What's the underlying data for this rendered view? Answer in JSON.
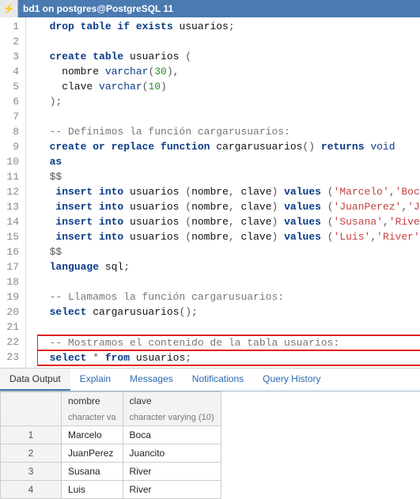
{
  "header": {
    "title": "bd1 on postgres@PostgreSQL 11"
  },
  "code_lines": [
    {
      "n": 1,
      "tokens": [
        [
          "kw",
          "  drop"
        ],
        [
          "kw",
          " table"
        ],
        [
          "kw",
          " if"
        ],
        [
          "kw",
          " exists"
        ],
        [
          "fn",
          " usuarios"
        ],
        [
          "pn",
          ";"
        ]
      ]
    },
    {
      "n": 2,
      "tokens": []
    },
    {
      "n": 3,
      "tokens": [
        [
          "kw",
          "  create"
        ],
        [
          "kw",
          " table"
        ],
        [
          "fn",
          " usuarios"
        ],
        [
          "pn",
          " ("
        ]
      ]
    },
    {
      "n": 4,
      "tokens": [
        [
          "fn",
          "    nombre "
        ],
        [
          "ty",
          "varchar"
        ],
        [
          "pn",
          "("
        ],
        [
          "num",
          "30"
        ],
        [
          "pn",
          "),"
        ]
      ]
    },
    {
      "n": 5,
      "tokens": [
        [
          "fn",
          "    clave "
        ],
        [
          "ty",
          "varchar"
        ],
        [
          "pn",
          "("
        ],
        [
          "num",
          "10"
        ],
        [
          "pn",
          ")"
        ]
      ]
    },
    {
      "n": 6,
      "tokens": [
        [
          "pn",
          "  );"
        ]
      ]
    },
    {
      "n": 7,
      "tokens": []
    },
    {
      "n": 8,
      "tokens": [
        [
          "cm",
          "  -- Definimos la función cargarusuarios:"
        ]
      ]
    },
    {
      "n": 9,
      "tokens": [
        [
          "kw",
          "  create"
        ],
        [
          "kw",
          " or"
        ],
        [
          "kw",
          " replace"
        ],
        [
          "kw",
          " function"
        ],
        [
          "fn",
          " cargarusuarios"
        ],
        [
          "pn",
          "()"
        ],
        [
          "kw",
          " returns"
        ],
        [
          "ty",
          " void"
        ]
      ]
    },
    {
      "n": 10,
      "tokens": [
        [
          "kw",
          "  as"
        ]
      ]
    },
    {
      "n": 11,
      "tokens": [
        [
          "pn",
          "  $$"
        ]
      ]
    },
    {
      "n": 12,
      "tokens": [
        [
          "kw",
          "   insert"
        ],
        [
          "kw",
          " into"
        ],
        [
          "fn",
          " usuarios"
        ],
        [
          "pn",
          " ("
        ],
        [
          "fn",
          "nombre"
        ],
        [
          "pn",
          ", "
        ],
        [
          "fn",
          "clave"
        ],
        [
          "pn",
          ")"
        ],
        [
          "kw",
          " values"
        ],
        [
          "pn",
          " ("
        ],
        [
          "str",
          "'Marcelo'"
        ],
        [
          "pn",
          ","
        ],
        [
          "str",
          "'Boca'"
        ],
        [
          "pn",
          ");"
        ]
      ]
    },
    {
      "n": 13,
      "tokens": [
        [
          "kw",
          "   insert"
        ],
        [
          "kw",
          " into"
        ],
        [
          "fn",
          " usuarios"
        ],
        [
          "pn",
          " ("
        ],
        [
          "fn",
          "nombre"
        ],
        [
          "pn",
          ", "
        ],
        [
          "fn",
          "clave"
        ],
        [
          "pn",
          ")"
        ],
        [
          "kw",
          " values"
        ],
        [
          "pn",
          " ("
        ],
        [
          "str",
          "'JuanPerez'"
        ],
        [
          "pn",
          ","
        ],
        [
          "str",
          "'Juancito'"
        ],
        [
          "pn",
          ");"
        ]
      ]
    },
    {
      "n": 14,
      "tokens": [
        [
          "kw",
          "   insert"
        ],
        [
          "kw",
          " into"
        ],
        [
          "fn",
          " usuarios"
        ],
        [
          "pn",
          " ("
        ],
        [
          "fn",
          "nombre"
        ],
        [
          "pn",
          ", "
        ],
        [
          "fn",
          "clave"
        ],
        [
          "pn",
          ")"
        ],
        [
          "kw",
          " values"
        ],
        [
          "pn",
          " ("
        ],
        [
          "str",
          "'Susana'"
        ],
        [
          "pn",
          ","
        ],
        [
          "str",
          "'River'"
        ],
        [
          "pn",
          ");"
        ]
      ]
    },
    {
      "n": 15,
      "tokens": [
        [
          "kw",
          "   insert"
        ],
        [
          "kw",
          " into"
        ],
        [
          "fn",
          " usuarios"
        ],
        [
          "pn",
          " ("
        ],
        [
          "fn",
          "nombre"
        ],
        [
          "pn",
          ", "
        ],
        [
          "fn",
          "clave"
        ],
        [
          "pn",
          ")"
        ],
        [
          "kw",
          " values"
        ],
        [
          "pn",
          " ("
        ],
        [
          "str",
          "'Luis'"
        ],
        [
          "pn",
          ","
        ],
        [
          "str",
          "'River'"
        ],
        [
          "pn",
          ");"
        ]
      ]
    },
    {
      "n": 16,
      "tokens": [
        [
          "pn",
          "  $$"
        ]
      ]
    },
    {
      "n": 17,
      "tokens": [
        [
          "kw",
          "  language"
        ],
        [
          "fn",
          " sql"
        ],
        [
          "pn",
          ";"
        ]
      ]
    },
    {
      "n": 18,
      "tokens": []
    },
    {
      "n": 19,
      "tokens": [
        [
          "cm",
          "  -- Llamamos la función cargarusuarios:"
        ]
      ]
    },
    {
      "n": 20,
      "tokens": [
        [
          "kw",
          "  select"
        ],
        [
          "fn",
          " cargarusuarios"
        ],
        [
          "pn",
          "();"
        ]
      ]
    },
    {
      "n": 21,
      "tokens": []
    },
    {
      "n": 22,
      "hl": "top",
      "tokens": [
        [
          "cm",
          "  -- Mostramos el contenido de la tabla usuarios:"
        ]
      ]
    },
    {
      "n": 23,
      "hl": "bot",
      "tokens": [
        [
          "kw",
          "  select"
        ],
        [
          "pn",
          " * "
        ],
        [
          "kw",
          "from"
        ],
        [
          "fn",
          " usuarios"
        ],
        [
          "pn",
          ";"
        ]
      ]
    }
  ],
  "tabs": {
    "items": [
      {
        "label": "Data Output",
        "active": true
      },
      {
        "label": "Explain",
        "active": false
      },
      {
        "label": "Messages",
        "active": false
      },
      {
        "label": "Notifications",
        "active": false
      },
      {
        "label": "Query History",
        "active": false
      }
    ]
  },
  "result": {
    "columns": [
      {
        "name": "nombre",
        "type": "character va"
      },
      {
        "name": "clave",
        "type": "character varying (10)"
      }
    ],
    "rows": [
      {
        "n": 1,
        "cells": [
          "Marcelo",
          "Boca"
        ]
      },
      {
        "n": 2,
        "cells": [
          "JuanPerez",
          "Juancito"
        ]
      },
      {
        "n": 3,
        "cells": [
          "Susana",
          "River"
        ]
      },
      {
        "n": 4,
        "cells": [
          "Luis",
          "River"
        ]
      }
    ]
  }
}
